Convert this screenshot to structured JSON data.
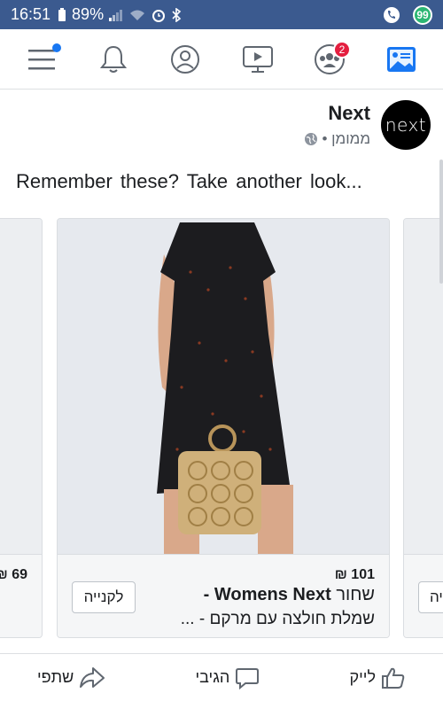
{
  "status_bar": {
    "time": "16:51",
    "battery": "89%",
    "messenger_badge": "99"
  },
  "nav": {
    "friend_requests_count": "2"
  },
  "post": {
    "page_name": "Next",
    "sponsored": "ממומן •",
    "avatar_text": "next",
    "caption": "Remember these? Take another look..."
  },
  "carousel": {
    "left_card_price": "₪ 69",
    "main_card": {
      "price": "₪ 101",
      "title_bold": "Womens Next -",
      "title_rest": " שחור",
      "title_line2": "שמלת חולצה עם מרקם - ...",
      "buy_label": "לקנייה"
    },
    "right_card_buy_label": "לקנייה"
  },
  "actions": {
    "like": "לייק",
    "comment": "הגיבי",
    "share": "שתפי"
  },
  "colors": {
    "status_bar": "#3b5a8f",
    "accent": "#1877f2",
    "badge_red": "#e41e3f"
  }
}
